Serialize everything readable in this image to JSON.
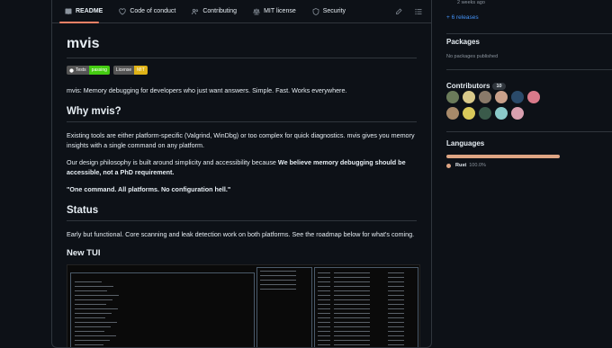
{
  "tabs": [
    {
      "label": "README",
      "icon": "book-icon",
      "active": true
    },
    {
      "label": "Code of conduct",
      "icon": "heart-icon"
    },
    {
      "label": "Contributing",
      "icon": "people-icon"
    },
    {
      "label": "MIT license",
      "icon": "law-icon"
    },
    {
      "label": "Security",
      "icon": "shield-icon"
    }
  ],
  "readme": {
    "title": "mvis",
    "badges": [
      {
        "left": "Tests",
        "right": "passing",
        "color": "#4c1"
      },
      {
        "left": "License",
        "right": "MIT",
        "color": "#dfb317"
      }
    ],
    "intro": "mvis: Memory debugging for developers who just want answers. Simple. Fast. Works everywhere.",
    "why_heading": "Why mvis?",
    "why_p1": "Existing tools are either platform-specific (Valgrind, WinDbg) or too complex for quick diagnostics. mvis gives you memory insights with a single command on any platform.",
    "why_p2_pre": "Our design philosophy is built around simplicity and accessibility because ",
    "why_p2_strong": "We believe memory debugging should be accessible, not a PhD requirement.",
    "quote": "\"One command. All platforms. No configuration hell.\"",
    "status_heading": "Status",
    "status_p": "Early but functional. Core scanning and leak detection work on both platforms. See the roadmap below for what's coming.",
    "tui_heading": "New TUI"
  },
  "sidebar": {
    "releases_time": "2 weeks ago",
    "releases_more": "+ 6 releases",
    "packages_heading": "Packages",
    "packages_none": "No packages published",
    "contributors_heading": "Contributors",
    "contributors_count": "10",
    "avatar_colors": [
      "#6b7b5a",
      "#d9c98a",
      "#8a7a6a",
      "#c9a08a",
      "#2a4a6a",
      "#d97a8a",
      "#a88a6a",
      "#d9c95a",
      "#3a5a4a",
      "#8ac9c9",
      "#d9a0b0"
    ],
    "languages_heading": "Languages",
    "languages": [
      {
        "name": "Rust",
        "percent": "100.0%",
        "color": "#dea584"
      }
    ]
  }
}
